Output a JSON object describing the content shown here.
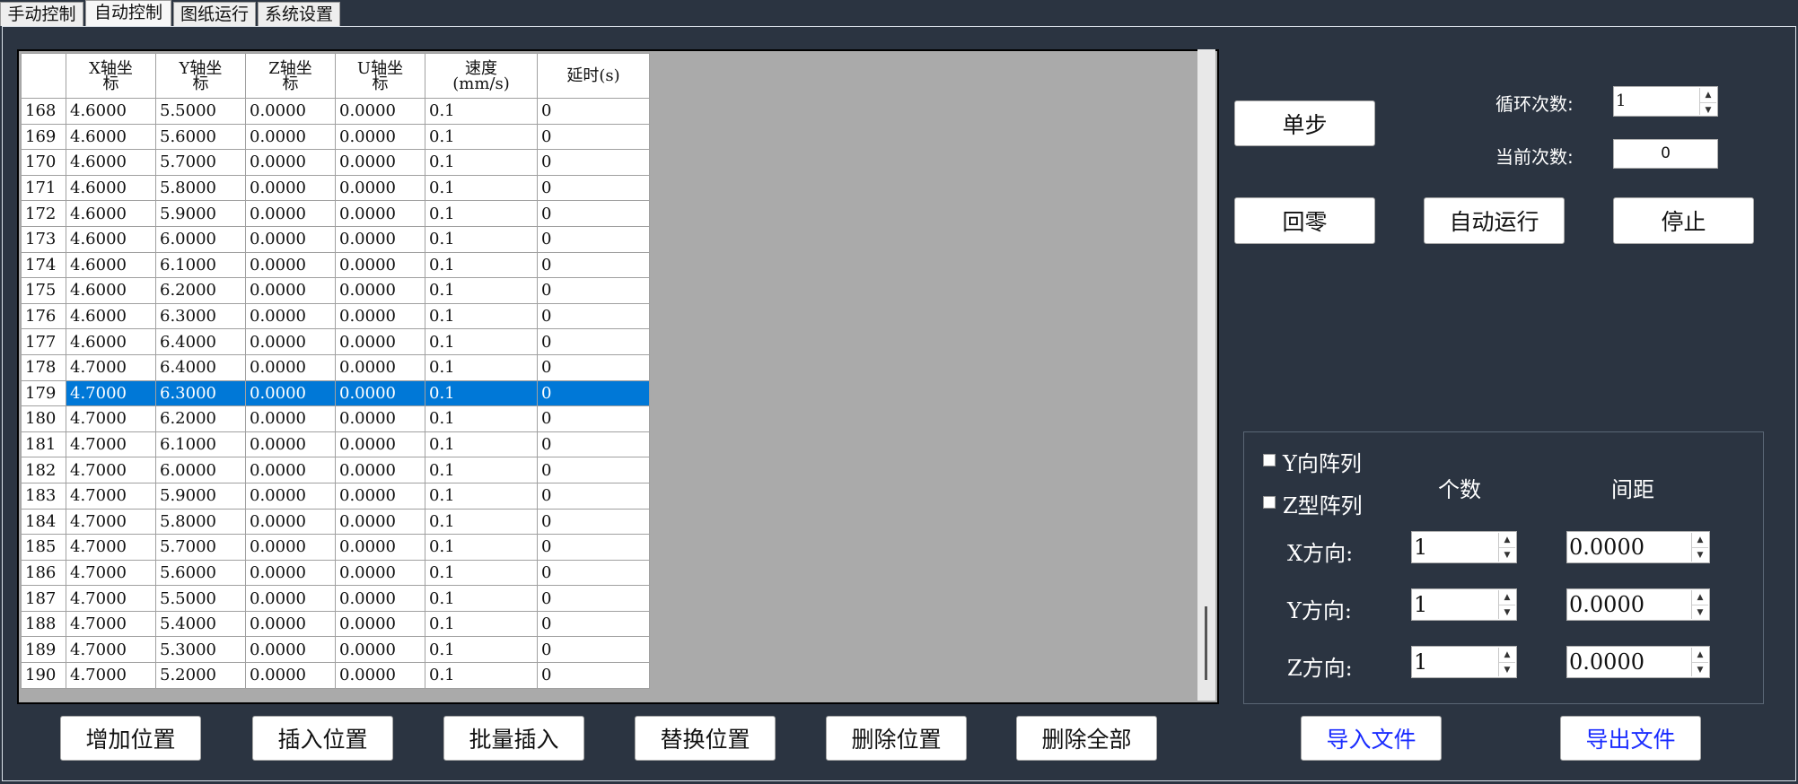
{
  "tabs": [
    "手动控制",
    "自动控制",
    "图纸运行",
    "系统设置"
  ],
  "grid": {
    "headers": [
      "",
      "X轴坐\n标",
      "Y轴坐\n标",
      "Z轴坐\n标",
      "U轴坐\n标",
      "速度\n(mm/s)",
      "延时(s)"
    ],
    "rows": [
      [
        "168",
        "4.6000",
        "5.5000",
        "0.0000",
        "0.0000",
        "0.1",
        "0"
      ],
      [
        "169",
        "4.6000",
        "5.6000",
        "0.0000",
        "0.0000",
        "0.1",
        "0"
      ],
      [
        "170",
        "4.6000",
        "5.7000",
        "0.0000",
        "0.0000",
        "0.1",
        "0"
      ],
      [
        "171",
        "4.6000",
        "5.8000",
        "0.0000",
        "0.0000",
        "0.1",
        "0"
      ],
      [
        "172",
        "4.6000",
        "5.9000",
        "0.0000",
        "0.0000",
        "0.1",
        "0"
      ],
      [
        "173",
        "4.6000",
        "6.0000",
        "0.0000",
        "0.0000",
        "0.1",
        "0"
      ],
      [
        "174",
        "4.6000",
        "6.1000",
        "0.0000",
        "0.0000",
        "0.1",
        "0"
      ],
      [
        "175",
        "4.6000",
        "6.2000",
        "0.0000",
        "0.0000",
        "0.1",
        "0"
      ],
      [
        "176",
        "4.6000",
        "6.3000",
        "0.0000",
        "0.0000",
        "0.1",
        "0"
      ],
      [
        "177",
        "4.6000",
        "6.4000",
        "0.0000",
        "0.0000",
        "0.1",
        "0"
      ],
      [
        "178",
        "4.7000",
        "6.4000",
        "0.0000",
        "0.0000",
        "0.1",
        "0"
      ],
      [
        "179",
        "4.7000",
        "6.3000",
        "0.0000",
        "0.0000",
        "0.1",
        "0"
      ],
      [
        "180",
        "4.7000",
        "6.2000",
        "0.0000",
        "0.0000",
        "0.1",
        "0"
      ],
      [
        "181",
        "4.7000",
        "6.1000",
        "0.0000",
        "0.0000",
        "0.1",
        "0"
      ],
      [
        "182",
        "4.7000",
        "6.0000",
        "0.0000",
        "0.0000",
        "0.1",
        "0"
      ],
      [
        "183",
        "4.7000",
        "5.9000",
        "0.0000",
        "0.0000",
        "0.1",
        "0"
      ],
      [
        "184",
        "4.7000",
        "5.8000",
        "0.0000",
        "0.0000",
        "0.1",
        "0"
      ],
      [
        "185",
        "4.7000",
        "5.7000",
        "0.0000",
        "0.0000",
        "0.1",
        "0"
      ],
      [
        "186",
        "4.7000",
        "5.6000",
        "0.0000",
        "0.0000",
        "0.1",
        "0"
      ],
      [
        "187",
        "4.7000",
        "5.5000",
        "0.0000",
        "0.0000",
        "0.1",
        "0"
      ],
      [
        "188",
        "4.7000",
        "5.4000",
        "0.0000",
        "0.0000",
        "0.1",
        "0"
      ],
      [
        "189",
        "4.7000",
        "5.3000",
        "0.0000",
        "0.0000",
        "0.1",
        "0"
      ],
      [
        "190",
        "4.7000",
        "5.2000",
        "0.0000",
        "0.0000",
        "0.1",
        "0"
      ]
    ],
    "selected_row": "179"
  },
  "bottom_buttons": [
    "增加位置",
    "插入位置",
    "批量插入",
    "替换位置",
    "删除位置",
    "删除全部"
  ],
  "controls": {
    "single_step": "单步",
    "loop_label": "循环次数:",
    "loop_value": "1",
    "current_label": "当前次数:",
    "current_value": "0",
    "home": "回零",
    "auto_run": "自动运行",
    "stop": "停止"
  },
  "array": {
    "y_array": "Y向阵列",
    "z_array": "Z型阵列",
    "count_header": "个数",
    "spacing_header": "间距",
    "rows": [
      {
        "label": "X方向:",
        "count": "1",
        "spacing": "0.0000"
      },
      {
        "label": "Y方向:",
        "count": "1",
        "spacing": "0.0000"
      },
      {
        "label": "Z方向:",
        "count": "1",
        "spacing": "0.0000"
      }
    ]
  },
  "file": {
    "import": "导入文件",
    "export": "导出文件"
  },
  "colors": {
    "background": "#2b3441",
    "selection": "#0078d7",
    "file_button_text": "#1a2cff"
  }
}
